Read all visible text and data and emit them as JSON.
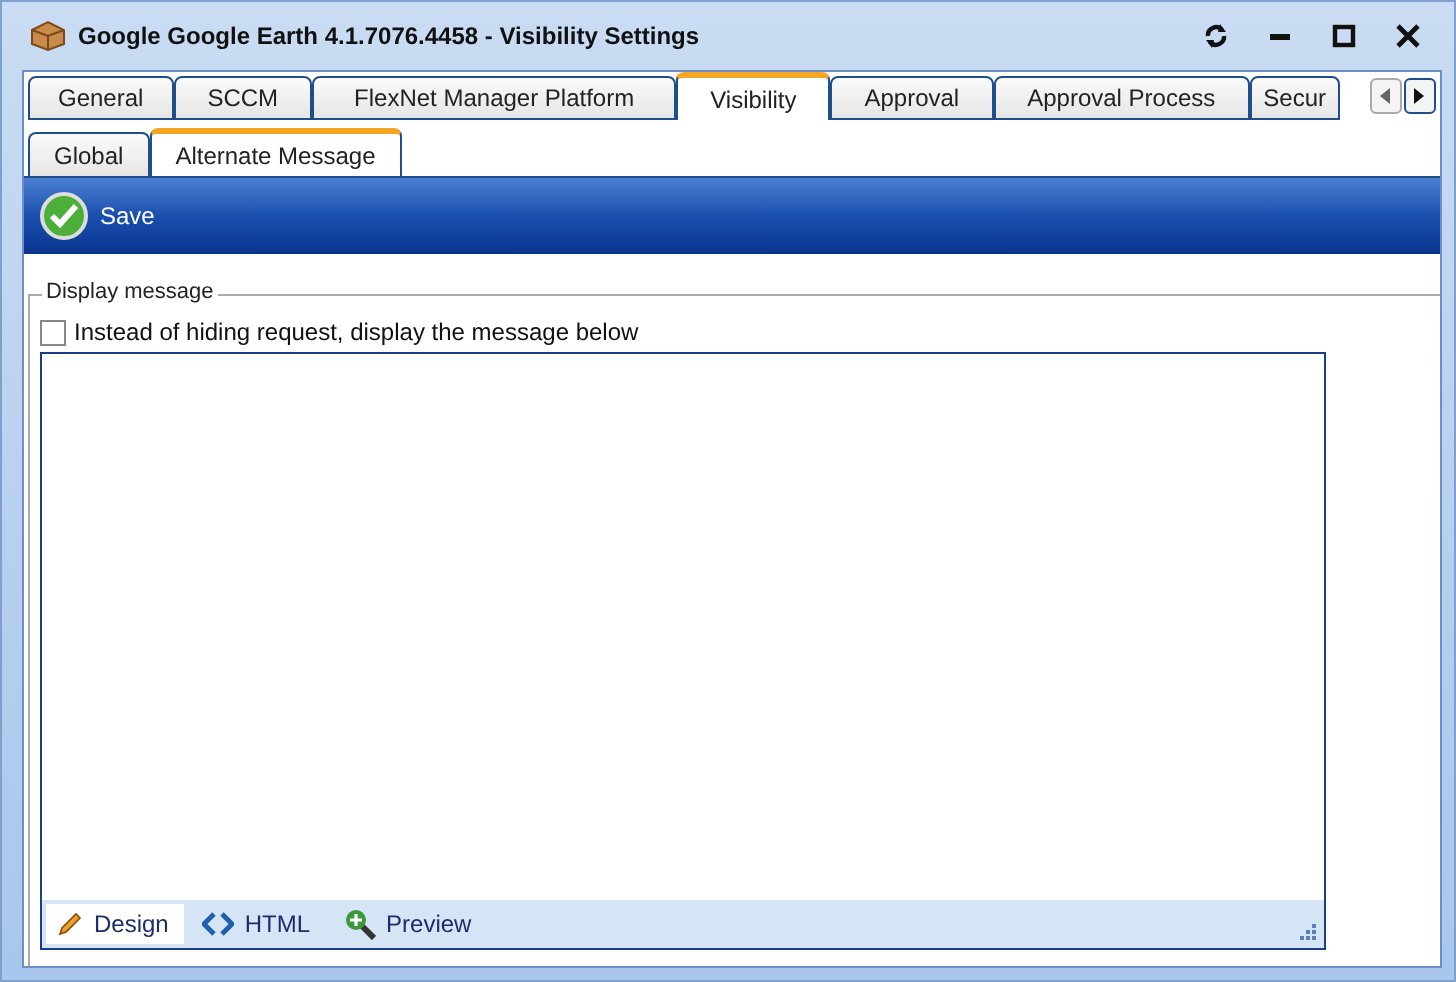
{
  "window": {
    "title": "Google Google Earth 4.1.7076.4458 - Visibility Settings"
  },
  "tabs": [
    {
      "label": "General",
      "selected": false
    },
    {
      "label": "SCCM",
      "selected": false
    },
    {
      "label": "FlexNet Manager Platform",
      "selected": false
    },
    {
      "label": "Visibility",
      "selected": true
    },
    {
      "label": "Approval",
      "selected": false
    },
    {
      "label": "Approval Process",
      "selected": false
    },
    {
      "label": "Secur",
      "selected": false
    }
  ],
  "subtabs": [
    {
      "label": "Global",
      "selected": false
    },
    {
      "label": "Alternate Message",
      "selected": true
    }
  ],
  "toolbar": {
    "save": "Save"
  },
  "group": {
    "legend": "Display message",
    "checkbox": {
      "label": "Instead of hiding request, display the message below",
      "checked": false
    }
  },
  "editor": {
    "modes": [
      {
        "label": "Design",
        "kind": "design",
        "selected": true
      },
      {
        "label": "HTML",
        "kind": "html",
        "selected": false
      },
      {
        "label": "Preview",
        "kind": "preview",
        "selected": false
      }
    ]
  }
}
